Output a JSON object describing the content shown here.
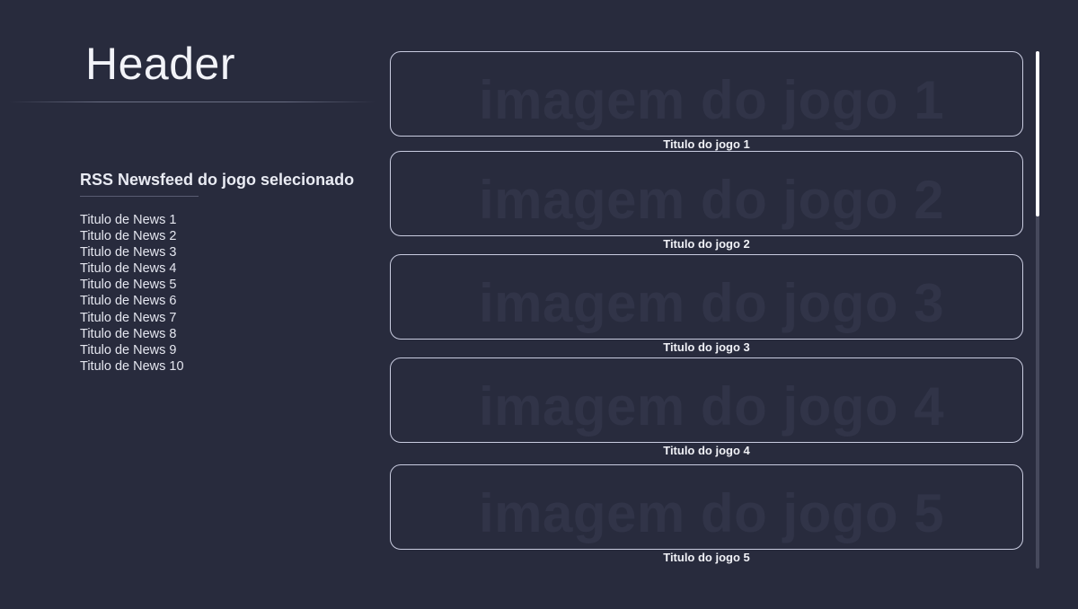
{
  "header": {
    "title": "Header"
  },
  "rss": {
    "title": "RSS Newsfeed do jogo selecionado",
    "items": [
      "Titulo de News 1",
      "Titulo de News 2",
      "Titulo de News 3",
      "Titulo de News 4",
      "Titulo de News 5",
      "Titulo de News 6",
      "Titulo de News 7",
      "Titulo de News 8",
      "Titulo de News 9",
      "Titulo de News 10"
    ]
  },
  "games": [
    {
      "image_text": "imagem do jogo 1",
      "title": "Titulo do jogo 1"
    },
    {
      "image_text": "imagem do jogo 2",
      "title": "Titulo do jogo 2"
    },
    {
      "image_text": "imagem do jogo 3",
      "title": "Titulo do jogo 3"
    },
    {
      "image_text": "imagem do jogo 4",
      "title": "Titulo do jogo 4"
    },
    {
      "image_text": "imagem do jogo 5",
      "title": "Titulo do jogo 5"
    }
  ],
  "colors": {
    "background": "#282b3d",
    "card_border": "#c9cce0",
    "placeholder_text": "#313448",
    "scroll_track": "#46495c",
    "scroll_thumb": "#ffffff"
  }
}
